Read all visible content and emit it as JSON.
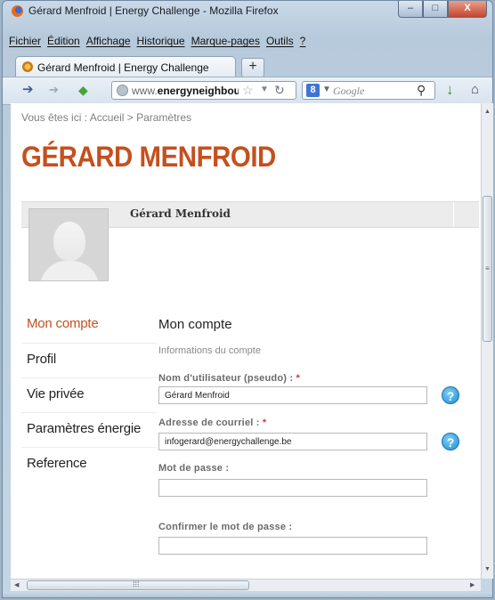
{
  "window": {
    "title": "Gérard Menfroid | Energy Challenge - Mozilla Firefox",
    "minimize": "–",
    "maximize": "□",
    "close": "X"
  },
  "menu": [
    "Fichier",
    "Édition",
    "Affichage",
    "Historique",
    "Marque-pages",
    "Outils",
    "?"
  ],
  "tab": {
    "label": "Gérard Menfroid | Energy Challenge",
    "new_tab": "+"
  },
  "nav": {
    "url_prefix": "www.",
    "url_domain": "energyneighbou",
    "search_placeholder": "Google",
    "search_engine_letter": "8"
  },
  "page": {
    "breadcrumb": "Vous êtes ici : Accueil > Paramètres",
    "title": "GÉRARD MENFROID",
    "profile_name": "Gérard Menfroid"
  },
  "side_menu": [
    "Mon compte",
    "Profil",
    "Vie privée",
    "Paramètres énergie",
    "Reference"
  ],
  "form": {
    "section_title": "Mon compte",
    "section_subtitle": "Informations du compte",
    "username_label": "Nom d'utilisateur (pseudo) :",
    "username_value": "Gérard Menfroid",
    "email_label": "Adresse de courriel :",
    "email_value": "infogerard@energychallenge.be",
    "password_label": "Mot de passe :",
    "confirm_label": "Confirmer le mot de passe :",
    "required_marker": "*",
    "help_symbol": "?"
  }
}
